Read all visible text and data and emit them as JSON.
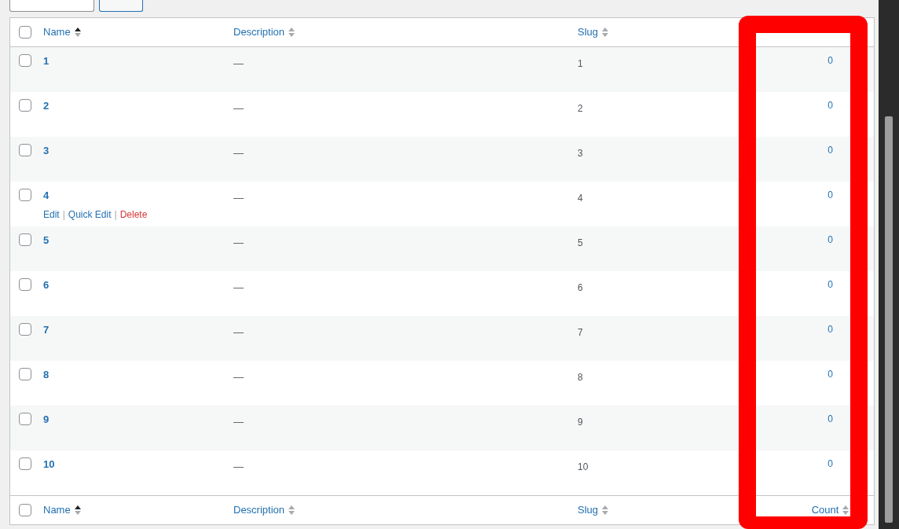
{
  "columns": [
    {
      "label": "Name",
      "sorted": true
    },
    {
      "label": "Description",
      "sorted": false
    },
    {
      "label": "Slug",
      "sorted": false
    }
  ],
  "select_all_checked": false,
  "rows": [
    {
      "name": "1",
      "description": "—",
      "slug": "1",
      "count": "0",
      "checked": false
    },
    {
      "name": "2",
      "description": "—",
      "slug": "2",
      "count": "0",
      "checked": false
    },
    {
      "name": "3",
      "description": "—",
      "slug": "3",
      "count": "0",
      "checked": false
    },
    {
      "name": "4",
      "description": "—",
      "slug": "4",
      "count": "0",
      "checked": false,
      "actions": [
        {
          "label": "Edit",
          "kind": "link"
        },
        {
          "label": "|",
          "kind": "separator"
        },
        {
          "label": "Quick Edit",
          "kind": "link"
        },
        {
          "label": "|",
          "kind": "separator"
        },
        {
          "label": "Delete",
          "kind": "delete"
        }
      ]
    },
    {
      "name": "5",
      "description": "—",
      "slug": "5",
      "count": "0",
      "checked": false
    },
    {
      "name": "6",
      "description": "—",
      "slug": "6",
      "count": "0",
      "checked": false
    },
    {
      "name": "7",
      "description": "—",
      "slug": "7",
      "count": "0",
      "checked": false
    },
    {
      "name": "8",
      "description": "—",
      "slug": "8",
      "count": "0",
      "checked": false
    },
    {
      "name": "9",
      "description": "—",
      "slug": "9",
      "count": "0",
      "checked": false
    },
    {
      "name": "10",
      "description": "—",
      "slug": "10",
      "count": "0",
      "checked": false
    }
  ],
  "footer_select_all_checked": false,
  "footer_columns": [
    {
      "label": "Name",
      "sorted": true
    },
    {
      "label": "Description",
      "sorted": false
    },
    {
      "label": "Slug",
      "sorted": false
    },
    {
      "label": "Count",
      "sorted": false
    }
  ],
  "annotation": {
    "kind": "highlight-box",
    "color": "#ff0000"
  }
}
